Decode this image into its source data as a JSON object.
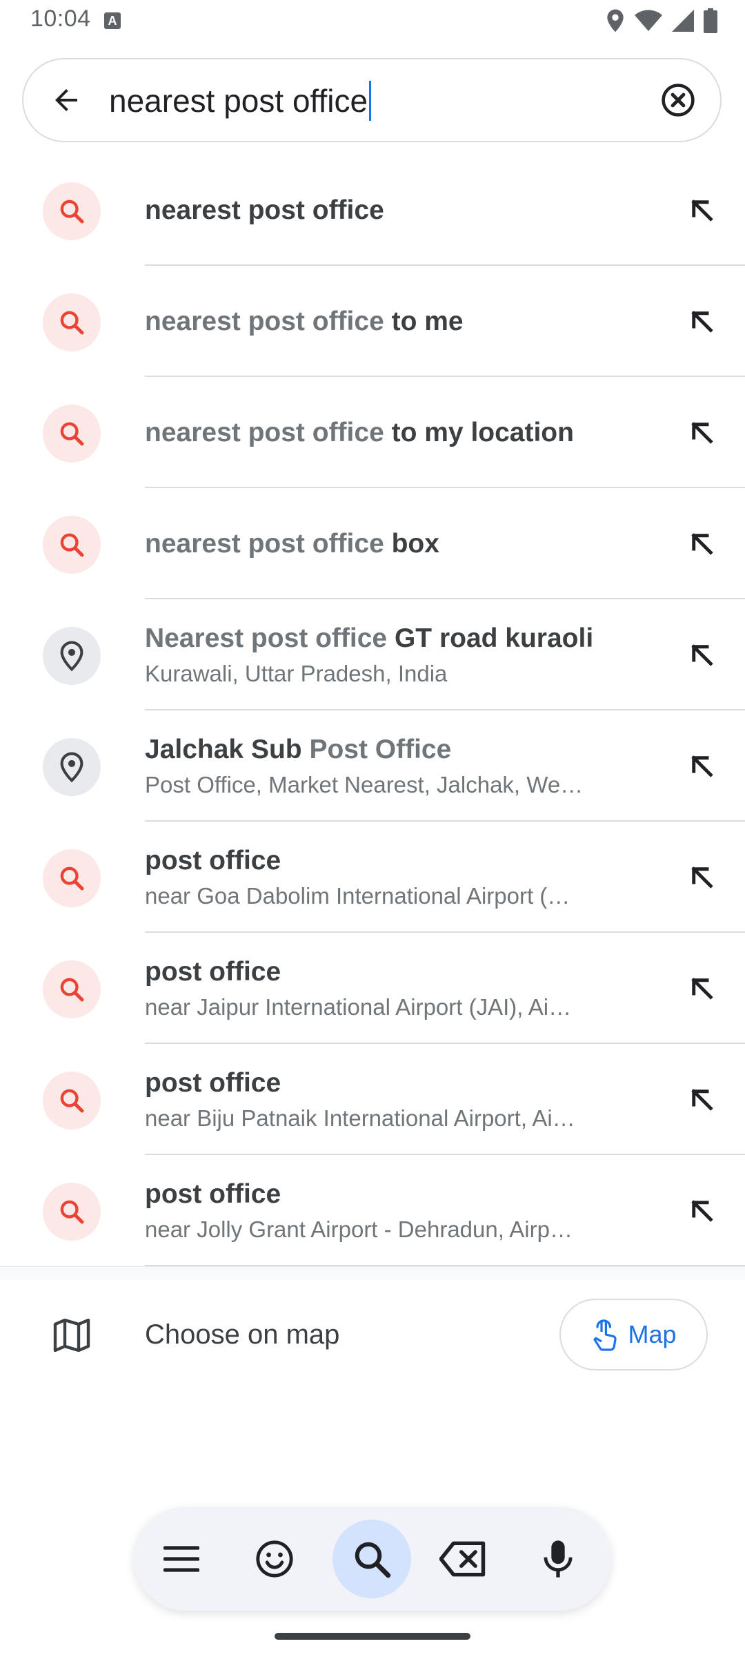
{
  "status_bar": {
    "time": "10:04",
    "notification_icon": "a-badge-icon",
    "icons": [
      "location-icon",
      "wifi-icon",
      "signal-icon",
      "battery-icon"
    ]
  },
  "search": {
    "value": "nearest post office",
    "back_icon": "arrow-back-icon",
    "clear_icon": "clear-circle-icon"
  },
  "suggestions": [
    {
      "icon": "search-icon",
      "muted": "",
      "strong": "nearest post office",
      "secondary": ""
    },
    {
      "icon": "search-icon",
      "muted": "nearest post office",
      "strong": " to me",
      "secondary": ""
    },
    {
      "icon": "search-icon",
      "muted": "nearest post office",
      "strong": " to my location",
      "secondary": ""
    },
    {
      "icon": "search-icon",
      "muted": "nearest post office",
      "strong": " box",
      "secondary": ""
    },
    {
      "icon": "pin-icon",
      "muted": "Nearest post office",
      "strong": " GT road kuraoli",
      "secondary": "Kurawali, Uttar Pradesh, India"
    },
    {
      "icon": "pin-icon",
      "muted_after": "Post Office",
      "strong": "Jalchak Sub ",
      "secondary": "Post Office, Market Nearest, Jalchak, We…"
    },
    {
      "icon": "search-icon",
      "muted": "",
      "strong": "post office",
      "secondary": "near Goa Dabolim International Airport (…"
    },
    {
      "icon": "search-icon",
      "muted": "",
      "strong": "post office",
      "secondary": "near Jaipur International Airport (JAI), Ai…"
    },
    {
      "icon": "search-icon",
      "muted": "",
      "strong": "post office",
      "secondary": "near Biju Patnaik International Airport, Ai…"
    },
    {
      "icon": "search-icon",
      "muted": "",
      "strong": "post office",
      "secondary": "near Jolly Grant Airport - Dehradun, Airp…"
    }
  ],
  "choose_on_map": {
    "label": "Choose on map",
    "button_label": "Map"
  },
  "keyboard_toolbar": {
    "buttons": [
      "menu-icon",
      "emoji-icon",
      "search-icon",
      "backspace-icon",
      "mic-icon"
    ],
    "active": "search-icon"
  },
  "colors": {
    "accent": "#1a73e8",
    "search_icon_red": "#ea4335",
    "search_icon_bg": "#fce8e6",
    "place_icon_bg": "#e8eaed"
  }
}
